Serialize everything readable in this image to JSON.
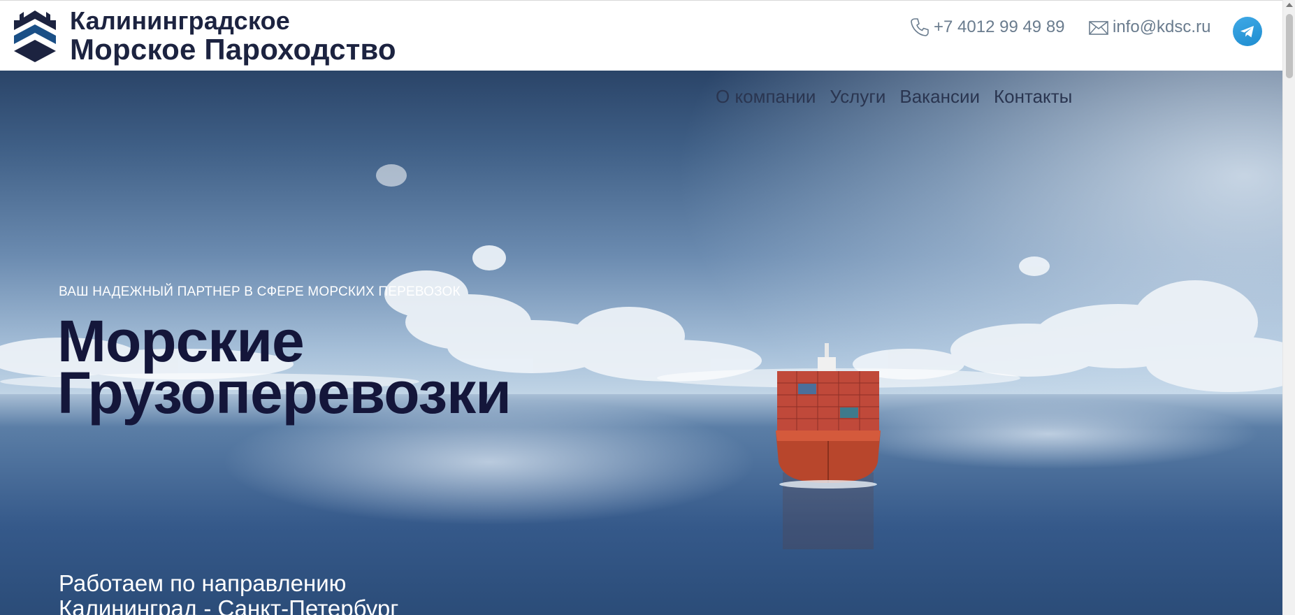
{
  "header": {
    "company_line1": "Калининградское",
    "company_line2": "Морское Пароходство",
    "phone": "+7 4012 99 49 89",
    "email": "info@kdsc.ru",
    "icons": {
      "logo": "kdsc-logo-icon",
      "phone": "phone-icon",
      "email": "envelope-icon",
      "telegram": "telegram-icon"
    }
  },
  "nav": {
    "items": [
      {
        "label": "О компании"
      },
      {
        "label": "Услуги"
      },
      {
        "label": "Вакансии"
      },
      {
        "label": "Контакты"
      }
    ]
  },
  "hero": {
    "tagline": "ВАШ НАДЕЖНЫЙ ПАРТНЕР В СФЕРЕ МОРСКИХ ПЕРЕВОЗОК",
    "title_line1": "Морские",
    "title_line2": "Грузоперевозки",
    "route_line1": "Работаем по направлению",
    "route_line2": "Калининград - Санкт-Петербург"
  },
  "colors": {
    "brand_dark": "#1c2340",
    "brand_blue": "#1a4f86",
    "title": "#14163a",
    "contact_text": "#6a7c8e",
    "telegram": "#2a9ee0"
  }
}
